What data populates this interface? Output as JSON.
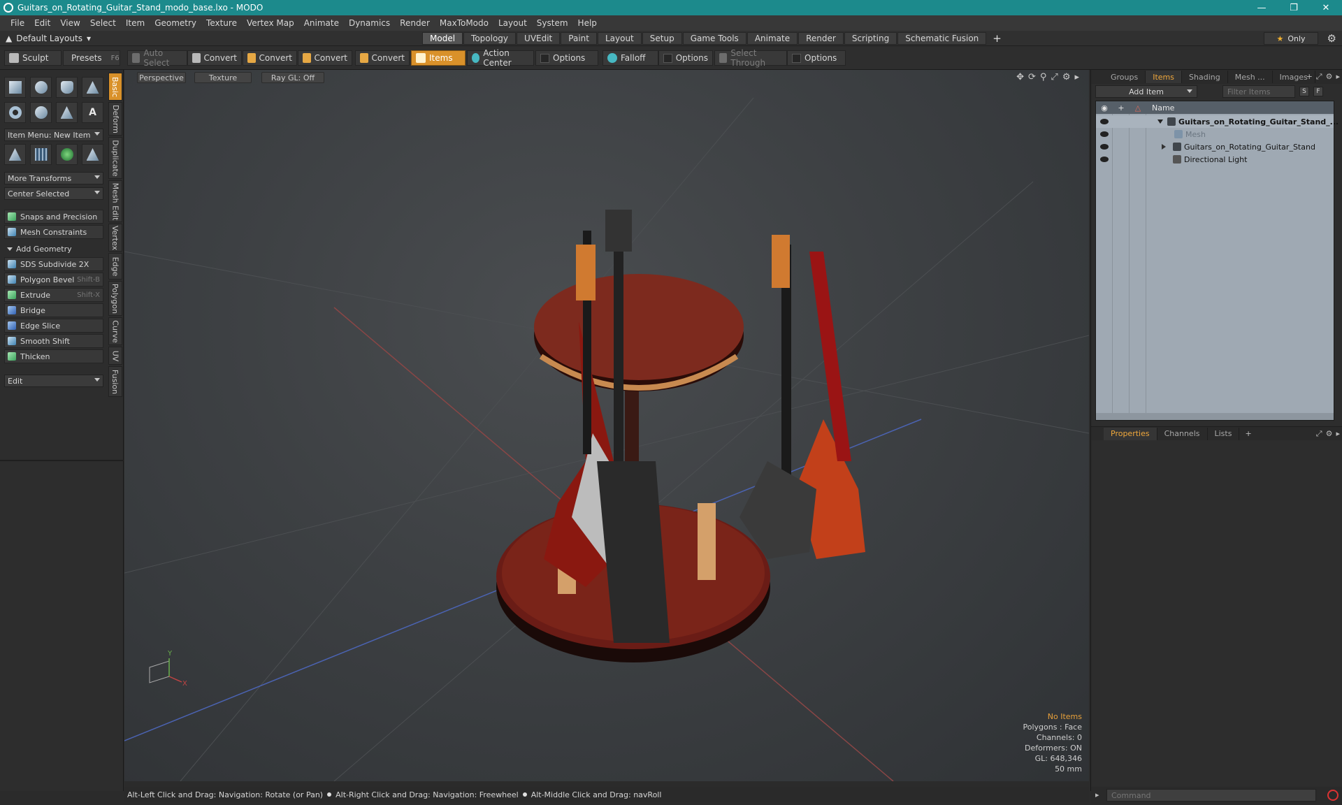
{
  "window": {
    "title": "Guitars_on_Rotating_Guitar_Stand_modo_base.lxo - MODO",
    "minimize": "—",
    "maximize": "❐",
    "close": "✕"
  },
  "menu": [
    "File",
    "Edit",
    "View",
    "Select",
    "Item",
    "Geometry",
    "Texture",
    "Vertex Map",
    "Animate",
    "Dynamics",
    "Render",
    "MaxToModo",
    "Layout",
    "System",
    "Help"
  ],
  "layouts": {
    "selector_label": "Default Layouts",
    "tabs": [
      "Model",
      "Topology",
      "UVEdit",
      "Paint",
      "Layout",
      "Setup",
      "Game Tools",
      "Animate",
      "Render",
      "Scripting",
      "Schematic Fusion"
    ],
    "active_tab": "Model",
    "add_symbol": "+",
    "only_label": "Only",
    "star_symbol": "★"
  },
  "toolbar": {
    "sculpt": "Sculpt",
    "presets": "Presets",
    "presets_shortcut": "F6",
    "auto_select": "Auto Select",
    "convert": "Convert",
    "items": "Items",
    "action_center": "Action Center",
    "options": "Options",
    "falloff": "Falloff",
    "select_through": "Select Through"
  },
  "left_panel": {
    "item_menu": "Item Menu: New Item",
    "more_transforms": "More Transforms",
    "center_selected": "Center Selected",
    "snaps": "Snaps and Precision",
    "mesh_constraints": "Mesh Constraints",
    "add_geometry": "Add Geometry",
    "tools": [
      {
        "label": "SDS Subdivide 2X",
        "shortcut": ""
      },
      {
        "label": "Polygon Bevel",
        "shortcut": "Shift-B"
      },
      {
        "label": "Extrude",
        "shortcut": "Shift-X"
      },
      {
        "label": "Bridge",
        "shortcut": ""
      },
      {
        "label": "Edge Slice",
        "shortcut": ""
      },
      {
        "label": "Smooth Shift",
        "shortcut": ""
      },
      {
        "label": "Thicken",
        "shortcut": ""
      }
    ],
    "edit": "Edit",
    "vertical_tabs": [
      "Basic",
      "Deform",
      "Duplicate",
      "Mesh Edit",
      "Vertex",
      "Edge",
      "Polygon",
      "Curve",
      "UV",
      "Fusion"
    ],
    "active_vertical_tab": "Basic"
  },
  "viewport": {
    "view_mode": "Perspective",
    "shading": "Texture",
    "raygl": "Ray GL: Off",
    "info": {
      "selection": "No Items",
      "polygons": "Polygons : Face",
      "channels": "Channels: 0",
      "deformers": "Deformers: ON",
      "gl": "GL: 648,346",
      "focal": "50 mm"
    },
    "axis_y": "Y",
    "axis_x": "X"
  },
  "right_panel": {
    "tabs": [
      "Groups",
      "Items",
      "Shading",
      "Mesh ...",
      "Images"
    ],
    "active_tab": "Items",
    "add_item": "Add Item",
    "filter_placeholder": "Filter Items",
    "s_btn": "S",
    "f_btn": "F",
    "list_header_name": "Name",
    "items": [
      {
        "label": "Guitars_on_Rotating_Guitar_Stand_...",
        "level": 0,
        "style": "bold"
      },
      {
        "label": "Mesh",
        "level": 1,
        "style": "dim"
      },
      {
        "label": "Guitars_on_Rotating_Guitar_Stand",
        "level": 1,
        "style": "normal"
      },
      {
        "label": "Directional Light",
        "level": 1,
        "style": "normal"
      }
    ],
    "props_tabs": [
      "Properties",
      "Channels",
      "Lists"
    ],
    "props_active": "Properties",
    "command_placeholder": "Command"
  },
  "status": [
    "Alt-Left Click and Drag: Navigation: Rotate (or Pan)",
    "Alt-Right Click and Drag: Navigation: Freewheel",
    "Alt-Middle Click and Drag: navRoll"
  ]
}
